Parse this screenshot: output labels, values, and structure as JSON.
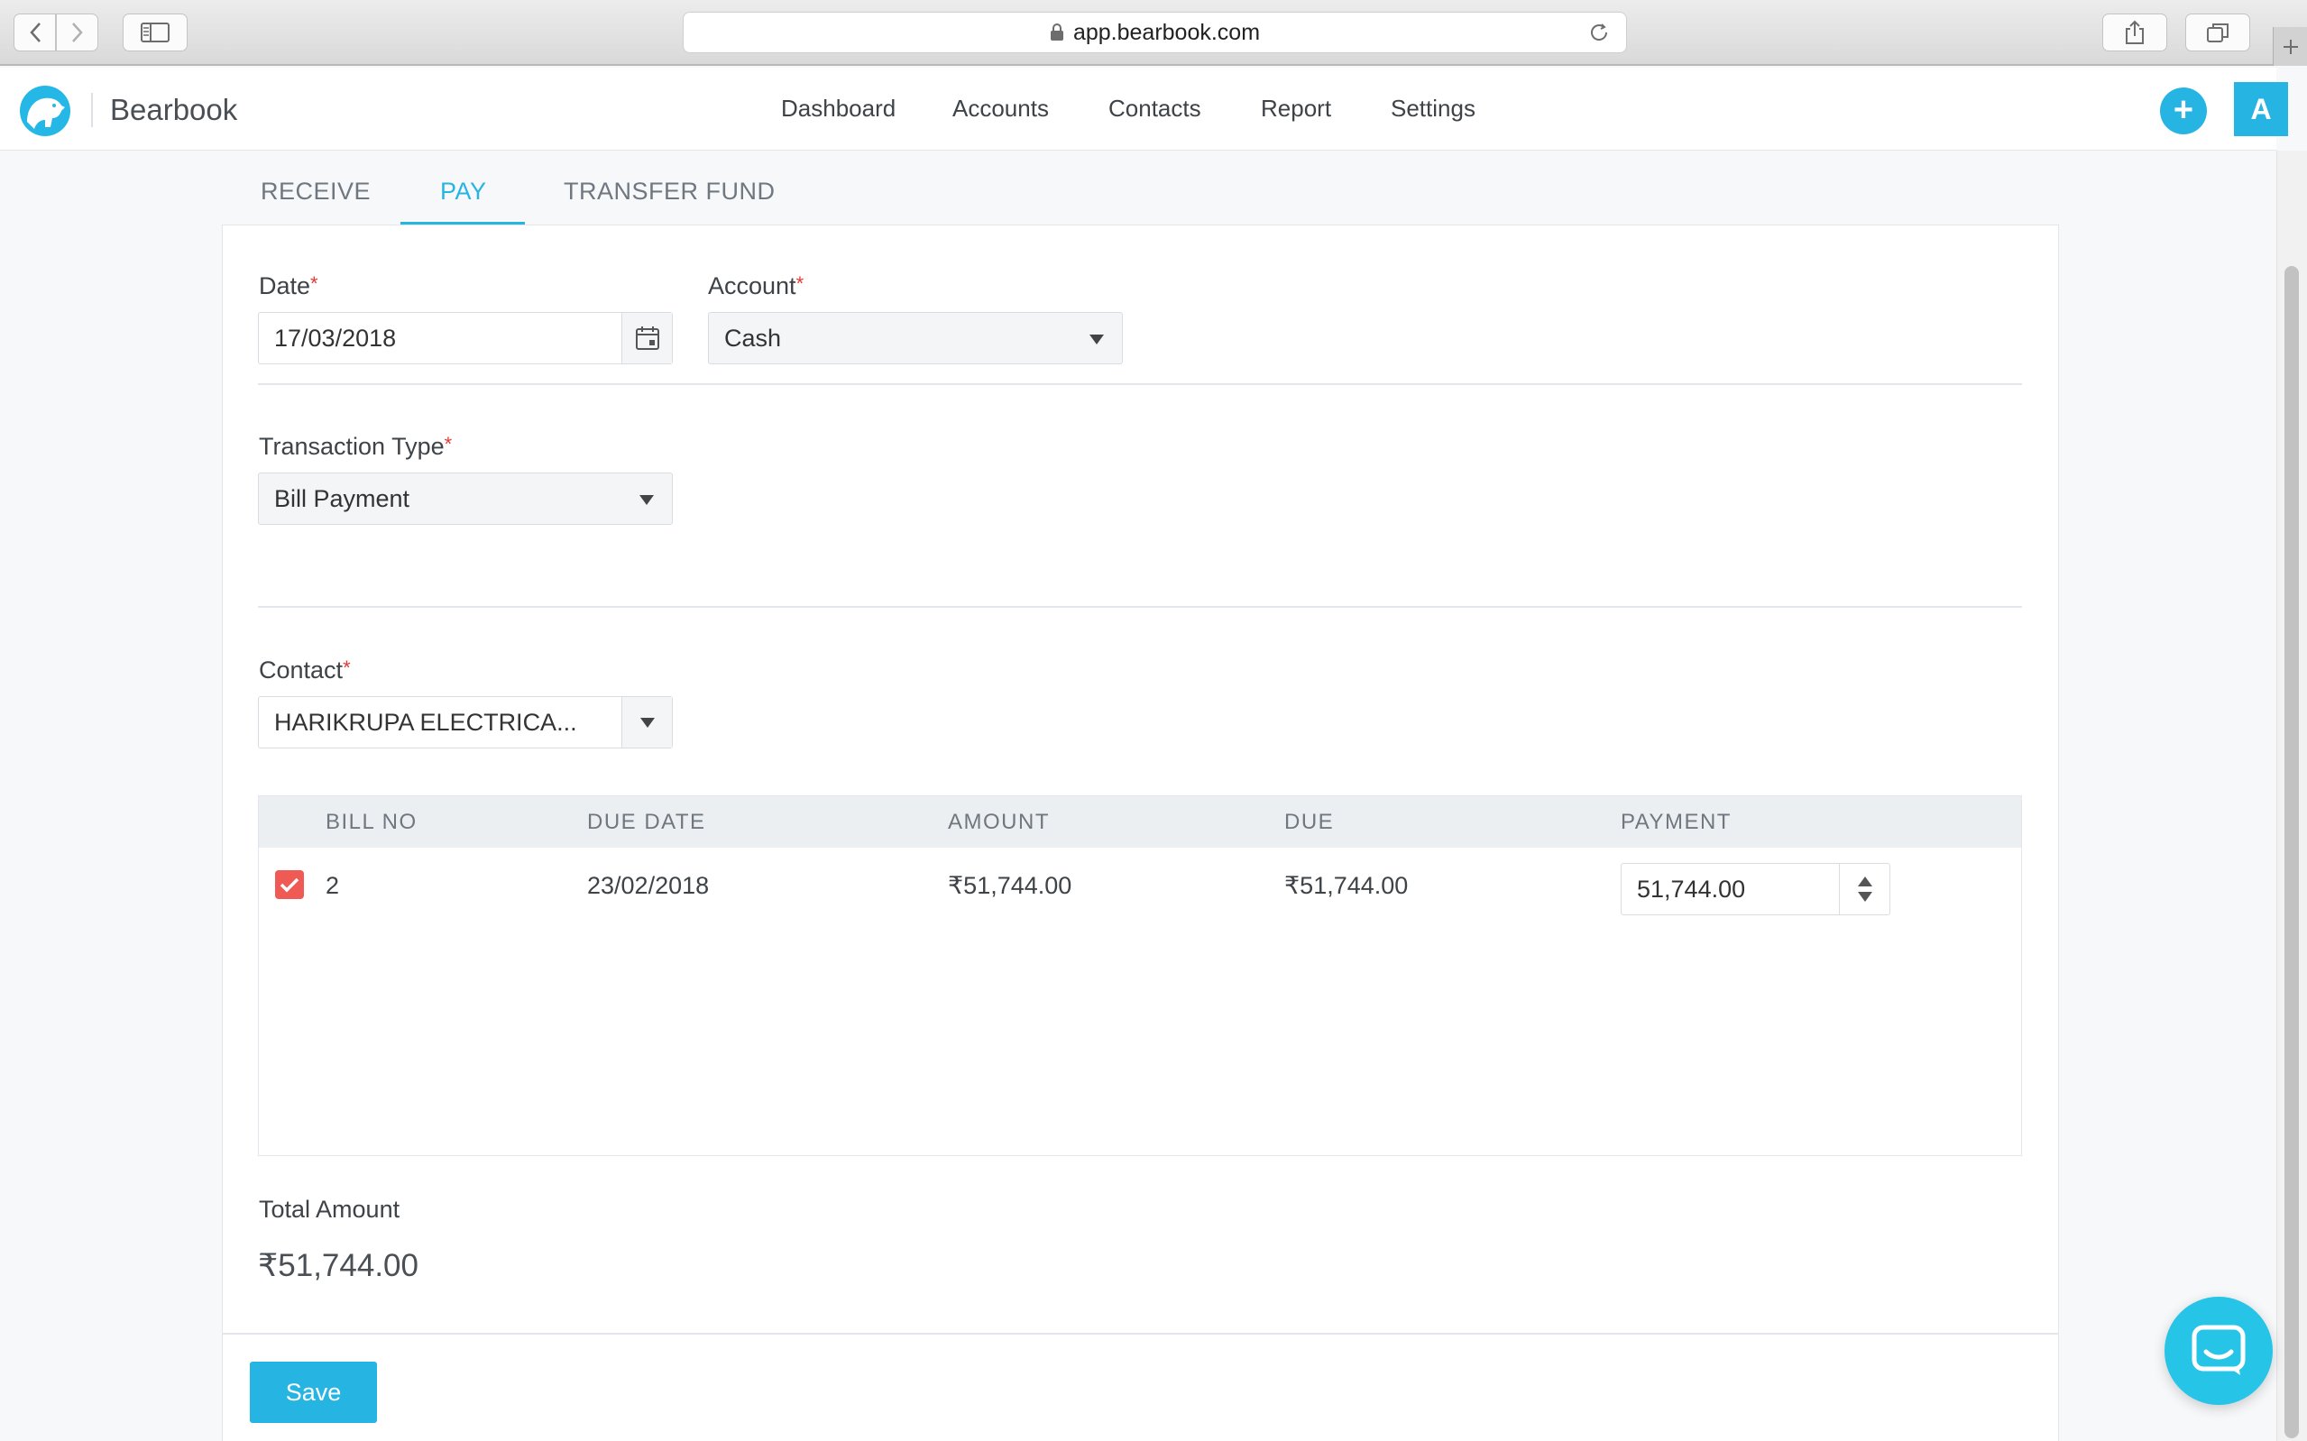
{
  "browser": {
    "url": "app.bearbook.com"
  },
  "app": {
    "brand": "Bearbook",
    "nav": [
      "Dashboard",
      "Accounts",
      "Contacts",
      "Report",
      "Settings"
    ],
    "add_label": "+",
    "avatar_initial": "A"
  },
  "tabs": {
    "receive": "RECEIVE",
    "pay": "PAY",
    "transfer": "TRANSFER FUND",
    "active": "PAY"
  },
  "form": {
    "date_label": "Date",
    "date_value": "17/03/2018",
    "account_label": "Account",
    "account_value": "Cash",
    "transaction_type_label": "Transaction Type",
    "transaction_type_value": "Bill Payment",
    "contact_label": "Contact",
    "contact_value": "HARIKRUPA ELECTRICA...",
    "required_mark": "*"
  },
  "table": {
    "headers": {
      "bill_no": "BILL NO",
      "due_date": "DUE DATE",
      "amount": "AMOUNT",
      "due": "DUE",
      "payment": "PAYMENT"
    },
    "rows": [
      {
        "checked": true,
        "bill_no": "2",
        "due_date": "23/02/2018",
        "amount": "₹51,744.00",
        "due": "₹51,744.00",
        "payment": "51,744.00"
      }
    ]
  },
  "total": {
    "label": "Total Amount",
    "value": "₹51,744.00"
  },
  "actions": {
    "save_label": "Save"
  },
  "colors": {
    "accent": "#26b5e3",
    "checkbox": "#ef5a55",
    "required": "#e53935"
  }
}
